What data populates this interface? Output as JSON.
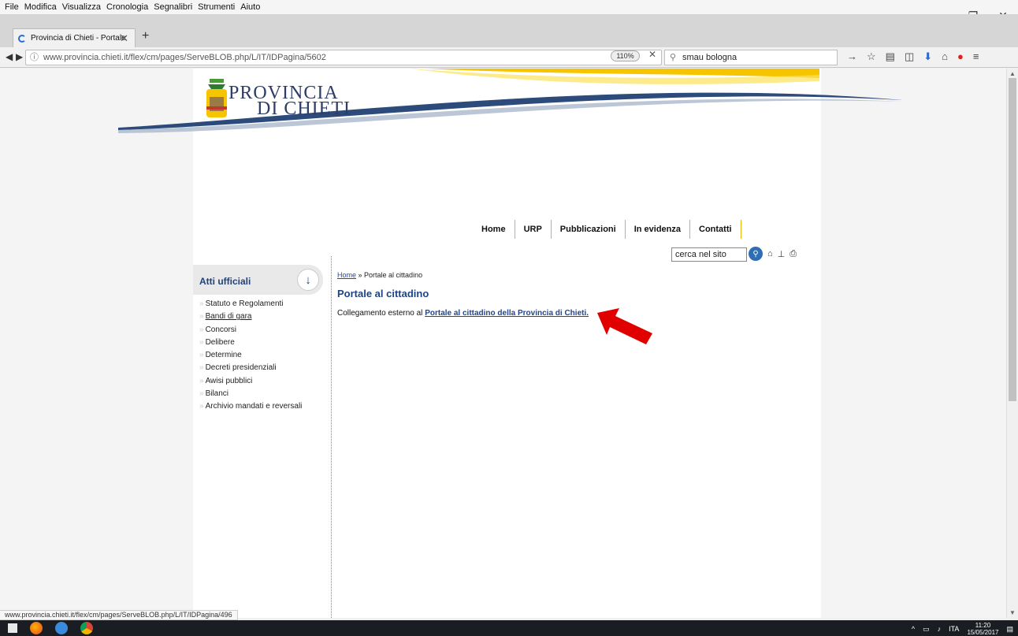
{
  "menubar": {
    "items": [
      "File",
      "Modifica",
      "Visualizza",
      "Cronologia",
      "Segnalibri",
      "Strumenti",
      "Aiuto"
    ]
  },
  "tab": {
    "title": "Provincia di Chieti - Portale"
  },
  "navbar": {
    "url": "www.provincia.chieti.it/flex/cm/pages/ServeBLOB.php/L/IT/IDPagina/5602",
    "zoom": "110%",
    "search_value": "smau bologna"
  },
  "logo": {
    "line1": "PROVINCIA",
    "line2": "DI CHIETI"
  },
  "topnav": [
    "Home",
    "URP",
    "Pubblicazioni",
    "In evidenza",
    "Contatti"
  ],
  "site_search": {
    "value": "cerca nel sito"
  },
  "sidebar": {
    "title": "Atti ufficiali",
    "items": [
      {
        "label": "Statuto e Regolamenti"
      },
      {
        "label": "Bandi di gara"
      },
      {
        "label": "Concorsi"
      },
      {
        "label": "Delibere"
      },
      {
        "label": "Determine"
      },
      {
        "label": "Decreti presidenziali"
      },
      {
        "label": "Awisi pubblici"
      },
      {
        "label": "Bilanci"
      },
      {
        "label": "Archivio mandati e reversali"
      }
    ]
  },
  "breadcrumb": {
    "home": "Home",
    "sep": " » ",
    "current": "Portale al cittadino"
  },
  "main": {
    "title": "Portale al cittadino",
    "text_prefix": "Collegamento esterno al ",
    "link_text": "Portale al cittadino della Provincia di Chieti."
  },
  "status_bar": {
    "url": "www.provincia.chieti.it/flex/cm/pages/ServeBLOB.php/L/IT/IDPagina/496"
  },
  "taskbar": {
    "lang": "ITA",
    "time": "11:20",
    "date": "15/05/2017"
  },
  "colors": {
    "accent_yellow": "#f7c400",
    "title_blue": "#1d4480",
    "arrow_red": "#e00000"
  }
}
